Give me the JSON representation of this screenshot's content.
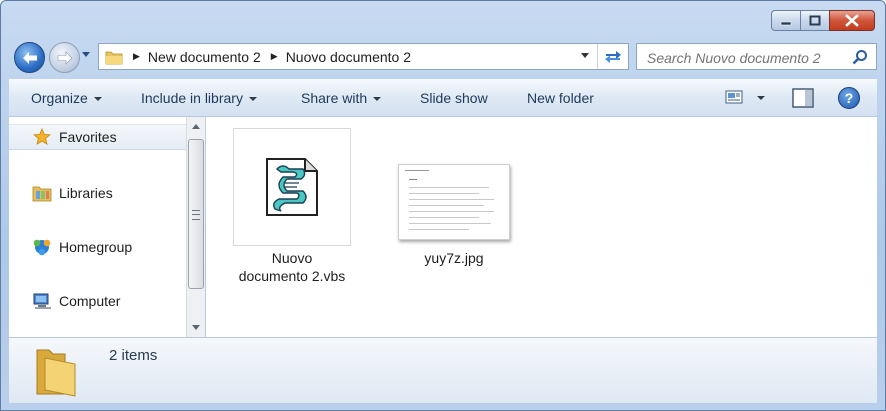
{
  "window": {
    "title_buttons": {
      "minimize": "minimize-icon",
      "maximize": "maximize-icon",
      "close": "close-icon"
    }
  },
  "address": {
    "breadcrumbs": [
      "New documento 2",
      "Nuovo documento 2"
    ]
  },
  "search": {
    "placeholder": "Search Nuovo documento 2"
  },
  "toolbar": {
    "organize": "Organize",
    "include_in_library": "Include in library",
    "share_with": "Share with",
    "slide_show": "Slide show",
    "new_folder": "New folder"
  },
  "sidebar": {
    "items": [
      {
        "label": "Favorites",
        "icon": "star-icon"
      },
      {
        "label": "Libraries",
        "icon": "libraries-icon"
      },
      {
        "label": "Homegroup",
        "icon": "homegroup-icon"
      },
      {
        "label": "Computer",
        "icon": "computer-icon"
      }
    ]
  },
  "files": [
    {
      "name": "Nuovo documento 2.vbs",
      "line1": "Nuovo",
      "line2": "documento 2.vbs",
      "icon": "script-icon"
    },
    {
      "name": "yuy7z.jpg",
      "icon": "image-thumbnail"
    }
  ],
  "status": {
    "text": "2 items"
  },
  "colors": {
    "accent": "#2a6cc4",
    "close": "#c23b1e",
    "toolbar_text": "#1e395b"
  }
}
